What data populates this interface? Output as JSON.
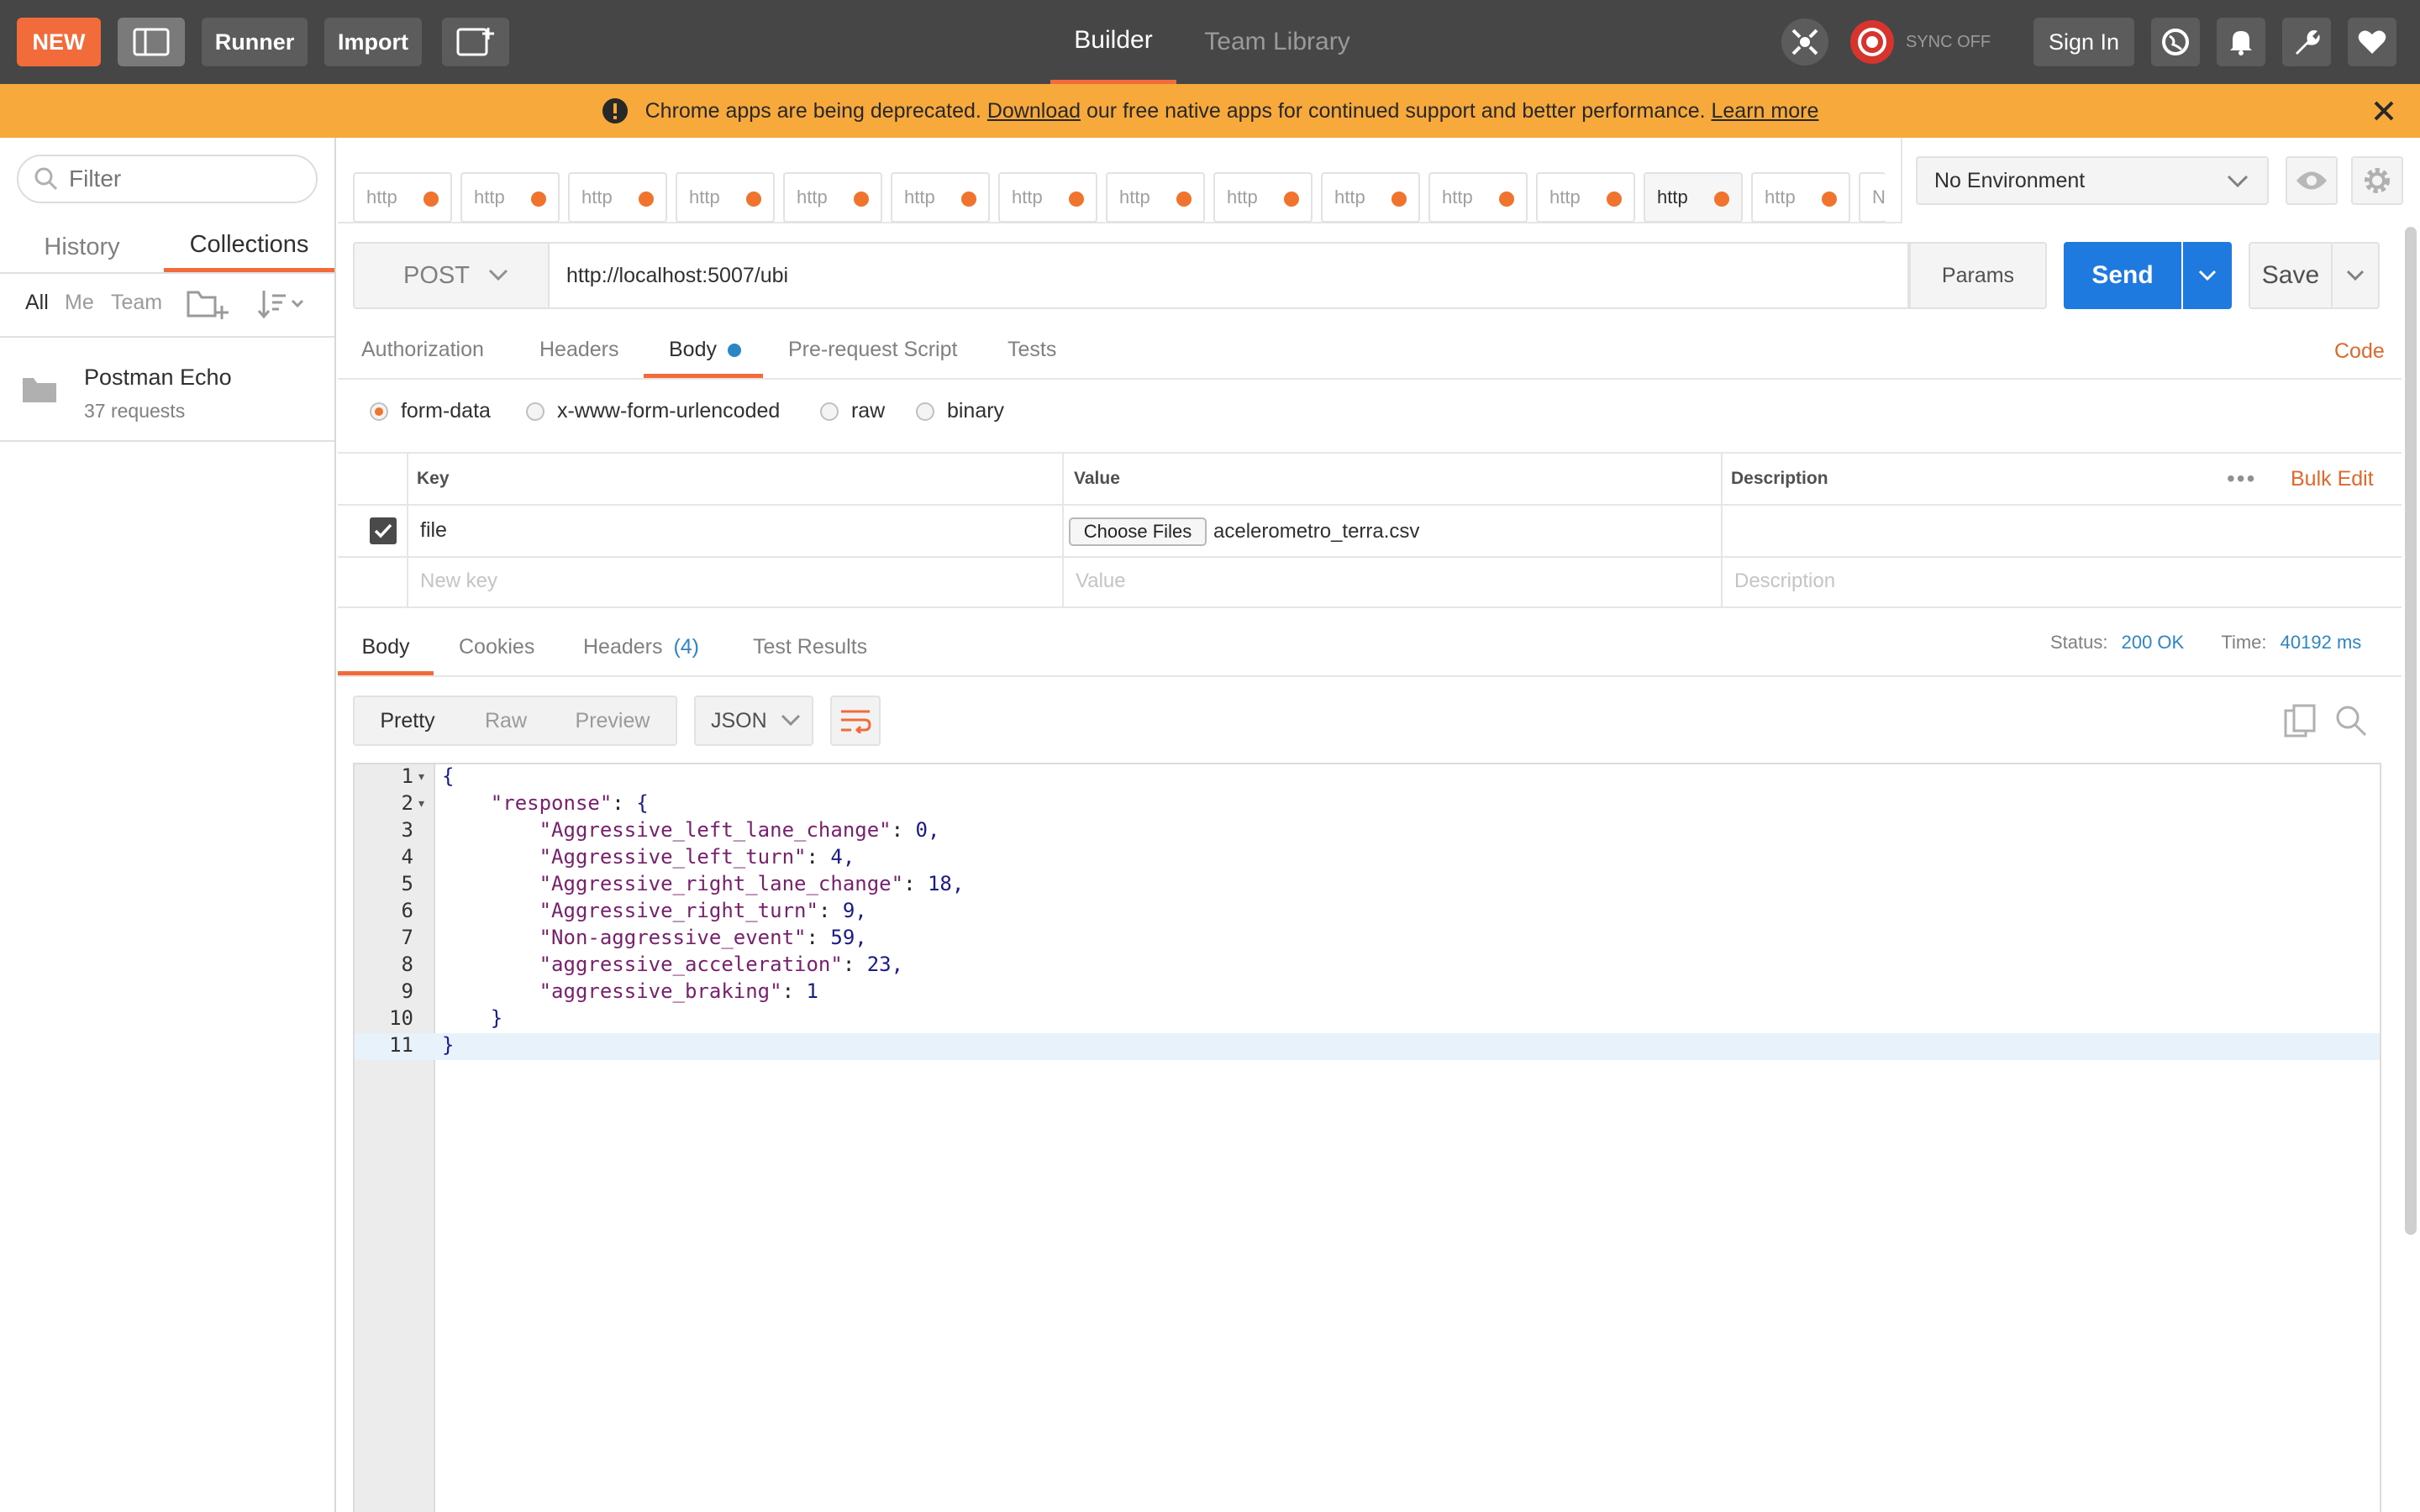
{
  "header": {
    "new_label": "NEW",
    "runner_label": "Runner",
    "import_label": "Import",
    "tabs": [
      {
        "label": "Builder"
      },
      {
        "label": "Team Library"
      }
    ],
    "sync_label": "SYNC OFF",
    "sign_in_label": "Sign In"
  },
  "banner": {
    "text_pre": "Chrome apps are being deprecated.",
    "download_link": "Download",
    "text_mid": "our free native apps for continued support and better performance.",
    "learn_more_link": "Learn more"
  },
  "sidebar": {
    "filter_placeholder": "Filter",
    "tabs": [
      {
        "label": "History"
      },
      {
        "label": "Collections"
      }
    ],
    "filters": [
      {
        "label": "All"
      },
      {
        "label": "Me"
      },
      {
        "label": "Team"
      }
    ],
    "collection": {
      "name": "Postman Echo",
      "count": "37 requests"
    }
  },
  "request_tabs": [
    {
      "label": "http"
    },
    {
      "label": "http"
    },
    {
      "label": "http"
    },
    {
      "label": "http"
    },
    {
      "label": "http"
    },
    {
      "label": "http"
    },
    {
      "label": "http"
    },
    {
      "label": "http"
    },
    {
      "label": "http"
    },
    {
      "label": "http"
    },
    {
      "label": "http"
    },
    {
      "label": "http"
    },
    {
      "label": "http"
    },
    {
      "label": "http"
    },
    {
      "label": "N"
    }
  ],
  "environment": {
    "selected": "No Environment"
  },
  "request": {
    "method": "POST",
    "url": "http://localhost:5007/ubi",
    "params_label": "Params",
    "send_label": "Send",
    "save_label": "Save"
  },
  "request_subtabs": [
    {
      "label": "Authorization"
    },
    {
      "label": "Headers"
    },
    {
      "label": "Body"
    },
    {
      "label": "Pre-request Script"
    },
    {
      "label": "Tests"
    }
  ],
  "code_link": "Code",
  "body_types": [
    {
      "label": "form-data"
    },
    {
      "label": "x-www-form-urlencoded"
    },
    {
      "label": "raw"
    },
    {
      "label": "binary"
    }
  ],
  "form_table": {
    "headers": {
      "key": "Key",
      "value": "Value",
      "description": "Description"
    },
    "bulk_edit": "Bulk Edit",
    "row": {
      "key": "file",
      "choose_files": "Choose Files",
      "file_name": "acelerometro_terra.csv"
    },
    "placeholders": {
      "key": "New key",
      "value": "Value",
      "description": "Description"
    }
  },
  "response_tabs": [
    {
      "label": "Body"
    },
    {
      "label": "Cookies"
    },
    {
      "label": "Headers",
      "count": "(4)"
    },
    {
      "label": "Test Results"
    }
  ],
  "response_status": {
    "status_label": "Status:",
    "status_value": "200 OK",
    "time_label": "Time:",
    "time_value": "40192 ms"
  },
  "view_modes": [
    {
      "label": "Pretty"
    },
    {
      "label": "Raw"
    },
    {
      "label": "Preview"
    }
  ],
  "format": "JSON",
  "response_lines": [
    {
      "n": "1",
      "text": "{"
    },
    {
      "n": "2",
      "text": "    \"response\": {"
    },
    {
      "n": "3",
      "text": "        \"Aggressive_left_lane_change\": 0,"
    },
    {
      "n": "4",
      "text": "        \"Aggressive_left_turn\": 4,"
    },
    {
      "n": "5",
      "text": "        \"Aggressive_right_lane_change\": 18,"
    },
    {
      "n": "6",
      "text": "        \"Aggressive_right_turn\": 9,"
    },
    {
      "n": "7",
      "text": "        \"Non-aggressive_event\": 59,"
    },
    {
      "n": "8",
      "text": "        \"aggressive_acceleration\": 23,"
    },
    {
      "n": "9",
      "text": "        \"aggressive_braking\": 1"
    },
    {
      "n": "10",
      "text": "    }"
    },
    {
      "n": "11",
      "text": "}"
    }
  ],
  "colors": {
    "accent": "#f26b3a",
    "send_blue": "#1f7ae0",
    "header_bg": "#464646",
    "banner_bg": "#f7a93c",
    "status_blue": "#2b86c5"
  }
}
